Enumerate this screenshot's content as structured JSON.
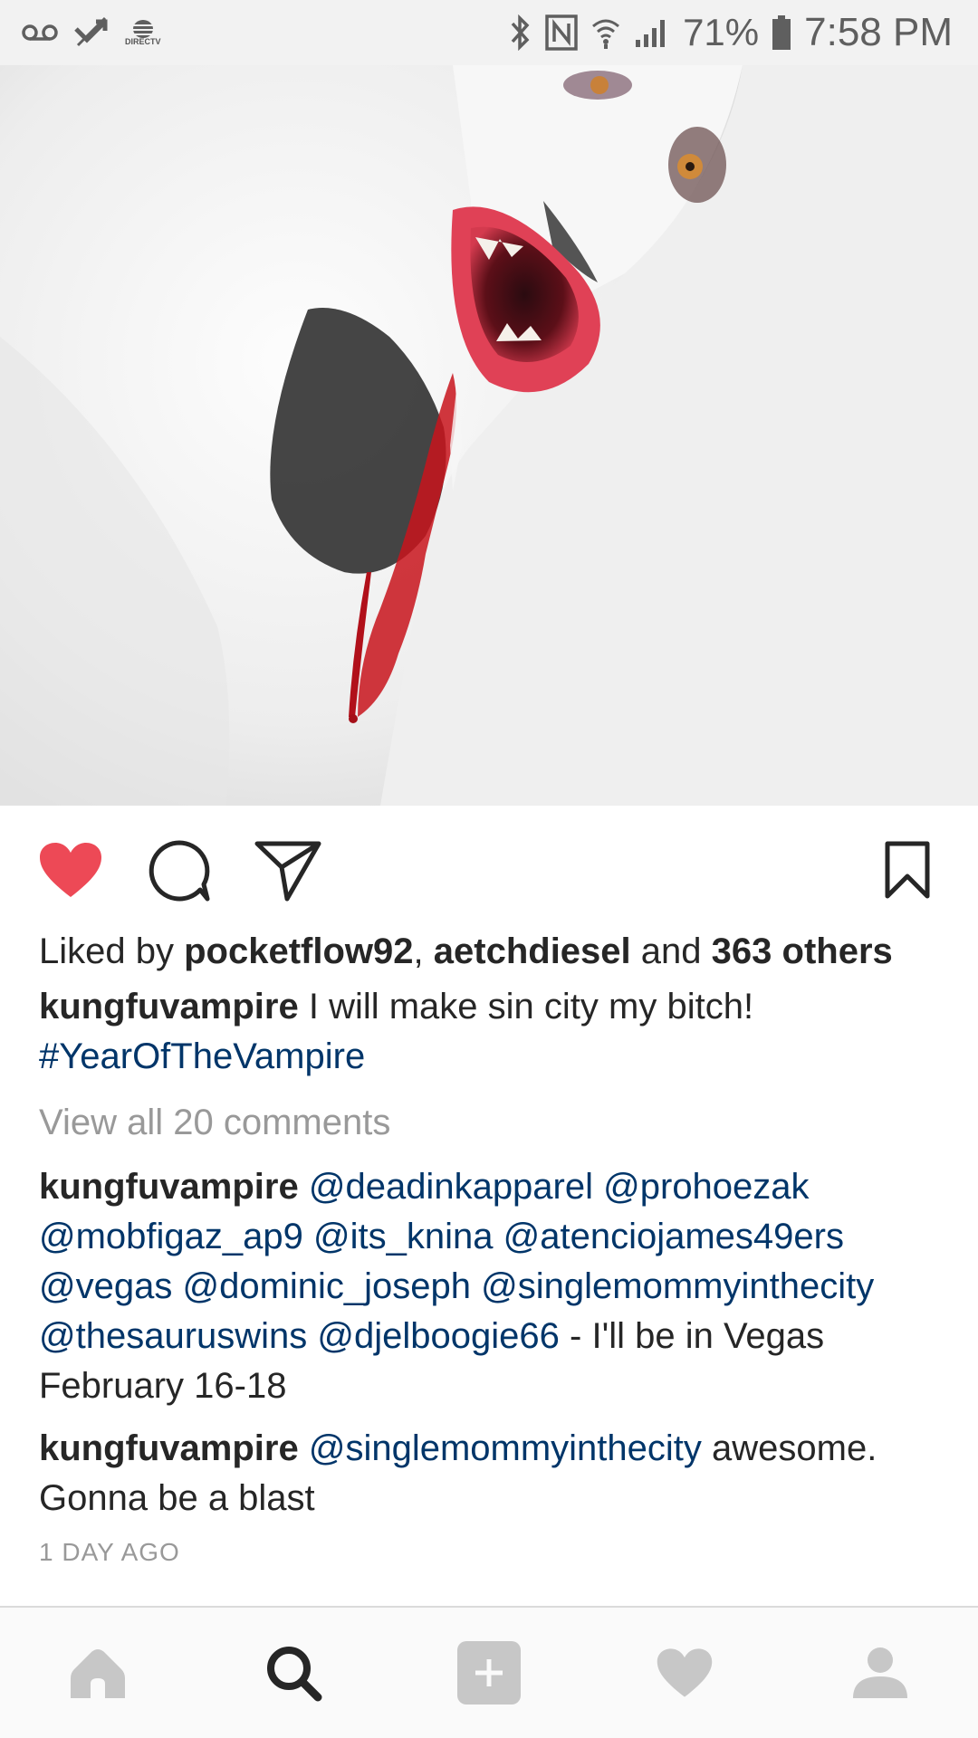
{
  "status_bar": {
    "carrier_label": "DIRECTV",
    "battery_percent": "71%",
    "time": "7:58 PM"
  },
  "post": {
    "liked": true,
    "likes_prefix": "Liked by",
    "liked_user_1": "pocketflow92",
    "liked_separator": ",",
    "liked_user_2": "aetchdiesel",
    "likes_and": "and",
    "likes_others": "363 others",
    "caption": {
      "username": "kungfuvampire",
      "text": "I will make sin city my bitch!",
      "hashtag": "#YearOfTheVampire"
    },
    "view_all_comments": "View all 20 comments",
    "comments": [
      {
        "username": "kungfuvampire",
        "mentions_line1": [
          "@deadinkapparel",
          "@prohoezak"
        ],
        "mentions_line2": [
          "@mobfigaz_ap9",
          "@its_knina",
          "@atenciojames49ers"
        ],
        "mentions_line3": [
          "@vegas",
          "@dominic_joseph",
          "@singlemommyinthecity"
        ],
        "mentions_line4": [
          "@thesauruswins",
          "@djelboogie66"
        ],
        "text": "- I'll be in Vegas February 16-18"
      },
      {
        "username": "kungfuvampire",
        "mention": "@singlemommyinthecity",
        "text": "awesome. Gonna be a blast"
      }
    ],
    "time_ago": "1 DAY AGO"
  },
  "colors": {
    "heart": "#ed4956",
    "link": "#003569",
    "muted": "#999999",
    "statusbar_bg": "#f2f2f2",
    "nav_bg": "#fafafa"
  },
  "icons": {
    "like": "heart-filled-icon",
    "comment": "comment-bubble-icon",
    "share": "paper-plane-icon",
    "save": "bookmark-icon",
    "nav": [
      "home-icon",
      "search-icon",
      "add-post-icon",
      "activity-heart-icon",
      "profile-icon"
    ]
  }
}
